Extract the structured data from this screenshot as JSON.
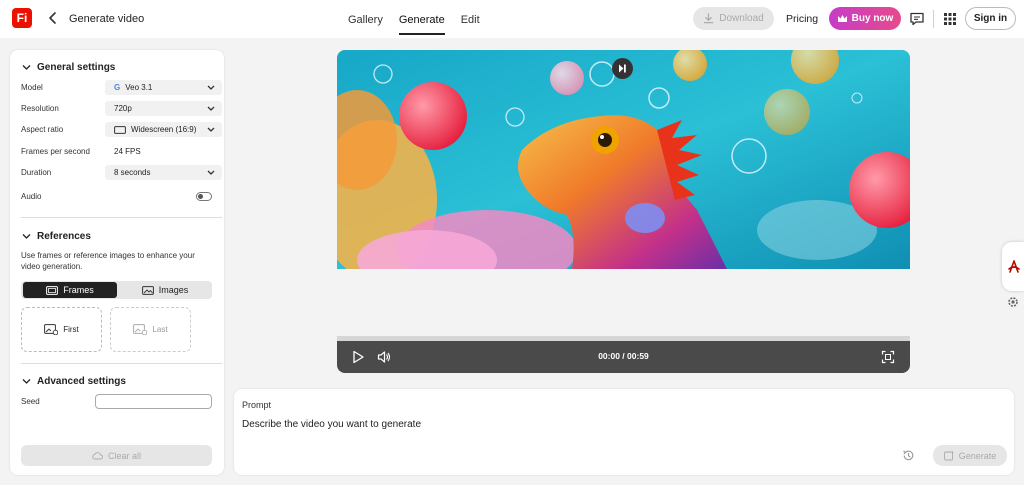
{
  "header": {
    "logo_text": "Fi",
    "title": "Generate video",
    "tabs": [
      {
        "label": "Gallery",
        "active": false
      },
      {
        "label": "Generate",
        "active": true
      },
      {
        "label": "Edit",
        "active": false
      }
    ],
    "download_label": "Download",
    "pricing_label": "Pricing",
    "buy_label": "Buy now",
    "signin_label": "Sign in"
  },
  "settings": {
    "general_title": "General settings",
    "model": {
      "label": "Model",
      "value": "Veo 3.1"
    },
    "resolution": {
      "label": "Resolution",
      "value": "720p"
    },
    "aspect": {
      "label": "Aspect ratio",
      "value": "Widescreen (16:9)"
    },
    "fps": {
      "label": "Frames per second",
      "value": "24 FPS"
    },
    "duration": {
      "label": "Duration",
      "value": "8 seconds"
    },
    "audio": {
      "label": "Audio",
      "enabled": false
    },
    "references_title": "References",
    "references_desc": "Use frames or reference images to enhance your video generation.",
    "frames_label": "Frames",
    "images_label": "Images",
    "first_label": "First",
    "last_label": "Last",
    "advanced_title": "Advanced settings",
    "seed_label": "Seed",
    "seed_value": "",
    "clear_label": "Clear all"
  },
  "player": {
    "time": "00:00 / 00:59"
  },
  "prompt": {
    "label": "Prompt",
    "text": "Describe the video you want to generate",
    "generate_label": "Generate"
  },
  "colors": {
    "brand": "#eb1000",
    "buy_gradient_start": "#c63bc9",
    "buy_gradient_end": "#e64b8b",
    "controls_bg": "#4a4a4a"
  }
}
